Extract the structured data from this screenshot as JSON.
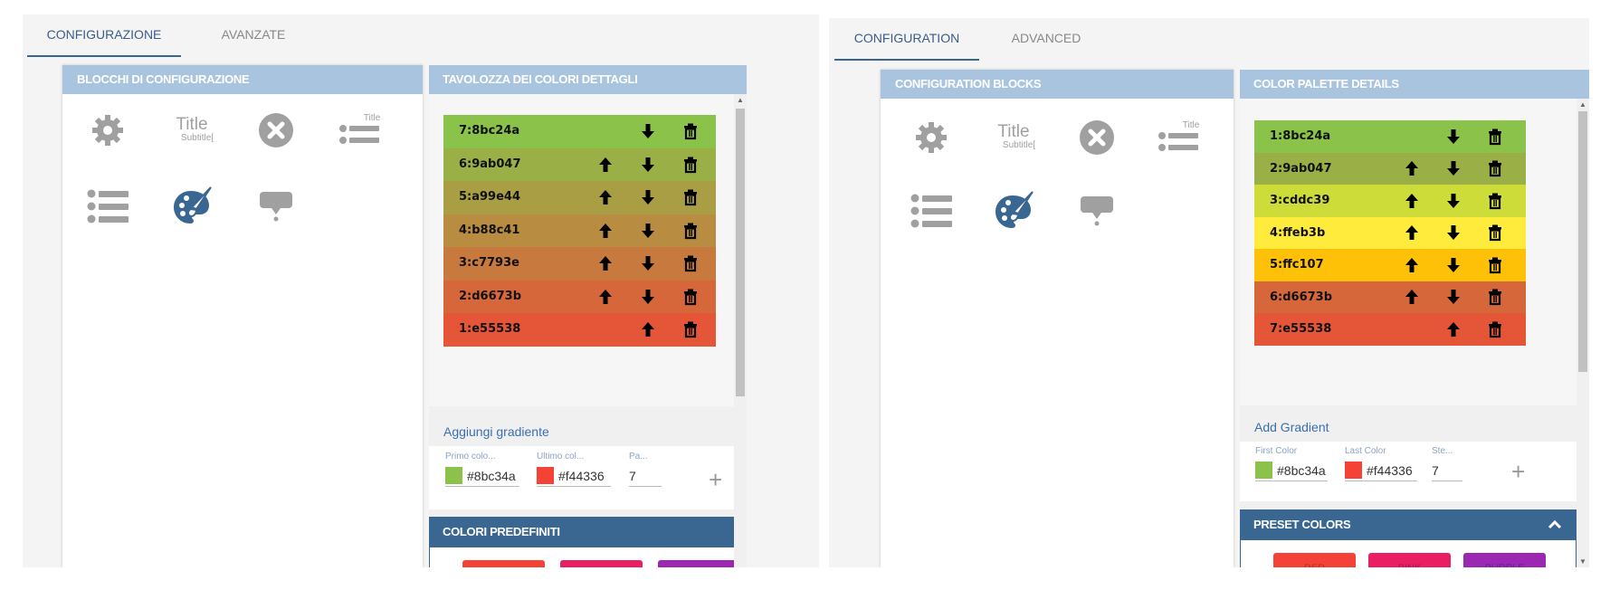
{
  "italian": {
    "tabs": [
      "CONFIGURAZIONE",
      "AVANZATE"
    ],
    "blocks_header": "BLOCCHI DI CONFIGURAZIONE",
    "details_header": "TAVOLOZZA DEI COLORI DETTAGLI",
    "palette": [
      {
        "label": "7:8bc24a",
        "color": "#8bc24a",
        "up": false,
        "down": true
      },
      {
        "label": "6:9ab047",
        "color": "#9ab047",
        "up": true,
        "down": true
      },
      {
        "label": "5:a99e44",
        "color": "#a99e44",
        "up": true,
        "down": true
      },
      {
        "label": "4:b88c41",
        "color": "#b88c41",
        "up": true,
        "down": true
      },
      {
        "label": "3:c7793e",
        "color": "#c7793e",
        "up": true,
        "down": true
      },
      {
        "label": "2:d6673b",
        "color": "#d6673b",
        "up": true,
        "down": true
      },
      {
        "label": "1:e55538",
        "color": "#e55538",
        "up": true,
        "down": false
      }
    ],
    "add_gradient": "Aggiungi gradiente",
    "first_color_label": "Primo colo...",
    "first_color_value": "#8bc34a",
    "last_color_label": "Ultimo col...",
    "last_color_value": "#f44336",
    "steps_label": "Pa...",
    "steps_value": "7",
    "preset_header": "COLORI PREDEFINITI",
    "presets": [
      {
        "label": "",
        "color": "#f44336"
      },
      {
        "label": "",
        "color": "#e91e63"
      },
      {
        "label": "",
        "color": "#9c27b0"
      }
    ]
  },
  "english": {
    "tabs": [
      "CONFIGURATION",
      "ADVANCED"
    ],
    "blocks_header": "CONFIGURATION BLOCKS",
    "details_header": "COLOR PALETTE DETAILS",
    "palette": [
      {
        "label": "1:8bc24a",
        "color": "#8bc24a",
        "up": false,
        "down": true
      },
      {
        "label": "2:9ab047",
        "color": "#9ab047",
        "up": true,
        "down": true
      },
      {
        "label": "3:cddc39",
        "color": "#cddc39",
        "up": true,
        "down": true
      },
      {
        "label": "4:ffeb3b",
        "color": "#ffeb3b",
        "up": true,
        "down": true
      },
      {
        "label": "5:ffc107",
        "color": "#ffc107",
        "up": true,
        "down": true
      },
      {
        "label": "6:d6673b",
        "color": "#d6673b",
        "up": true,
        "down": true
      },
      {
        "label": "7:e55538",
        "color": "#e55538",
        "up": true,
        "down": false
      }
    ],
    "add_gradient": "Add Gradient",
    "first_color_label": "First Color",
    "first_color_value": "#8bc34a",
    "last_color_label": "Last Color",
    "last_color_value": "#f44336",
    "steps_label": "Ste...",
    "steps_value": "7",
    "preset_header": "PRESET COLORS",
    "presets": [
      {
        "label": "RED",
        "color": "#f44336"
      },
      {
        "label": "PINK",
        "color": "#e91e63"
      },
      {
        "label": "PURPLE",
        "color": "#9c27b0"
      }
    ]
  },
  "block_icons": [
    "gear-icon",
    "title-subtitle-icon",
    "close-circle-icon",
    "titled-list-icon",
    "list-icon",
    "palette-brush-icon",
    "tooltip-icon"
  ],
  "block_icon_text": {
    "title": "Title",
    "subtitle": "Subtitle["
  },
  "colors": {
    "tab_accent": "#3a6792",
    "panel_header": "#a9c4de",
    "icon_gray": "#a0a0a0",
    "icon_active": "#3a6792"
  }
}
